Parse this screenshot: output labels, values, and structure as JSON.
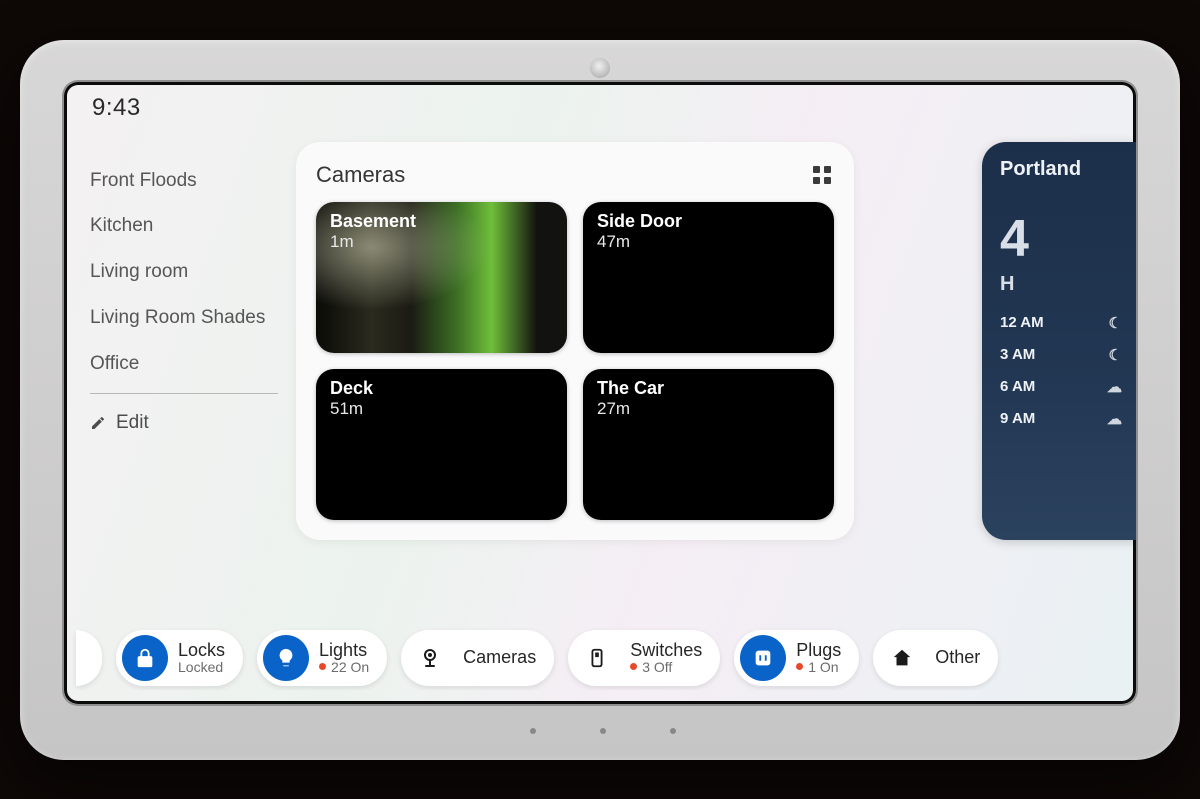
{
  "clock": "9:43",
  "rooms": [
    "Front Floods",
    "Kitchen",
    "Living room",
    "Living Room Shades",
    "Office"
  ],
  "edit_label": "Edit",
  "card": {
    "title": "Cameras",
    "tiles": [
      {
        "name": "Basement",
        "age": "1m",
        "preview": true
      },
      {
        "name": "Side Door",
        "age": "47m",
        "preview": false
      },
      {
        "name": "Deck",
        "age": "51m",
        "preview": false
      },
      {
        "name": "The Car",
        "age": "27m",
        "preview": false
      }
    ]
  },
  "weather": {
    "city": "Portland",
    "temp_now": "4",
    "hi_label": "H",
    "hours": [
      {
        "t": "12 AM"
      },
      {
        "t": "3 AM"
      },
      {
        "t": "6 AM"
      },
      {
        "t": "9 AM"
      }
    ]
  },
  "chips": {
    "locks": {
      "title": "Locks",
      "status": "Locked"
    },
    "lights": {
      "title": "Lights",
      "status": "22 On"
    },
    "cameras": {
      "title": "Cameras"
    },
    "switches": {
      "title": "Switches",
      "status": "3 Off"
    },
    "plugs": {
      "title": "Plugs",
      "status": "1 On"
    },
    "other": {
      "title": "Other"
    }
  }
}
